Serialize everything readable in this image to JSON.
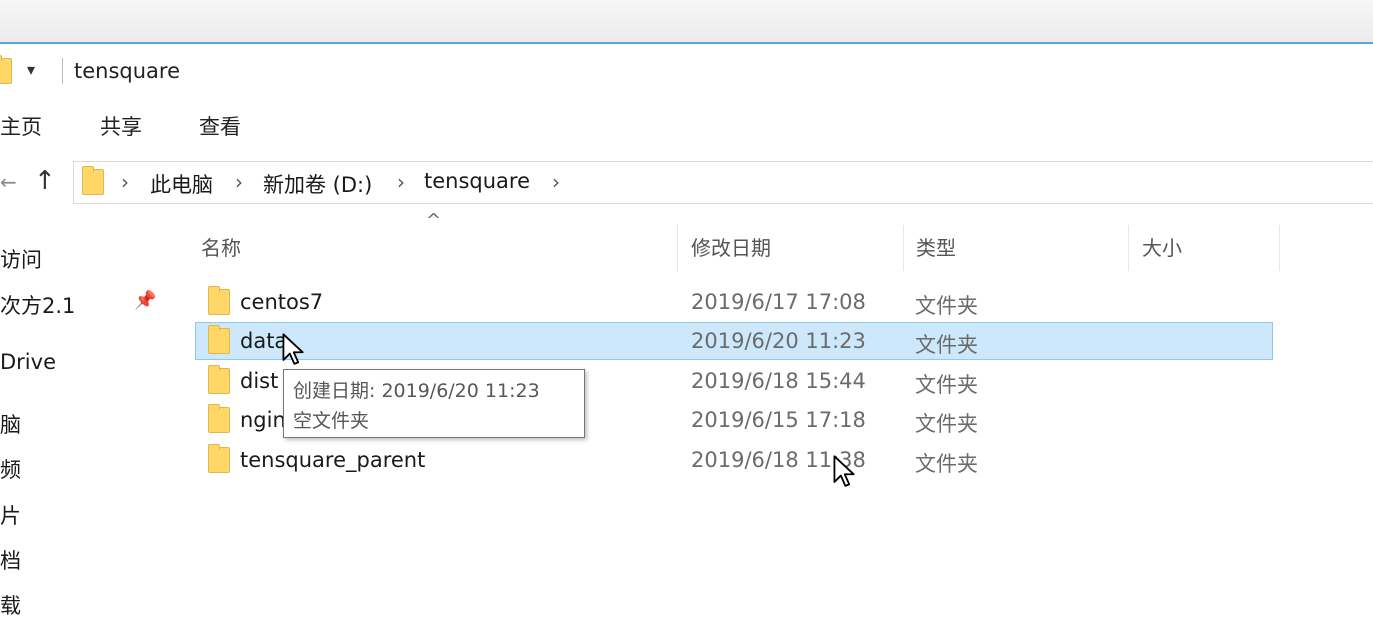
{
  "window": {
    "title": "tensquare",
    "quick_access_dropdown": "▾"
  },
  "ribbon": {
    "tabs": [
      {
        "label": "主页"
      },
      {
        "label": "共享"
      },
      {
        "label": "查看"
      }
    ]
  },
  "address_bar": {
    "back_glyph": "←",
    "up_glyph": "↑",
    "separator": "›",
    "breadcrumbs": [
      {
        "label": "此电脑"
      },
      {
        "label": "新加卷 (D:)"
      },
      {
        "label": "tensquare"
      }
    ]
  },
  "nav_pane": {
    "items": [
      {
        "label": "访问"
      },
      {
        "label": "次方2.1"
      },
      {
        "label": "Drive"
      },
      {
        "label": "脑"
      },
      {
        "label": "频"
      },
      {
        "label": "片"
      },
      {
        "label": "档"
      },
      {
        "label": "载"
      }
    ]
  },
  "file_list": {
    "sort_glyph": "^",
    "columns": {
      "name": "名称",
      "modified": "修改日期",
      "type": "类型",
      "size": "大小"
    },
    "rows": [
      {
        "name": "centos7",
        "modified": "2019/6/17 17:08",
        "type": "文件夹",
        "selected": false
      },
      {
        "name": "data",
        "modified": "2019/6/20 11:23",
        "type": "文件夹",
        "selected": true
      },
      {
        "name": "dist",
        "modified": "2019/6/18 15:44",
        "type": "文件夹",
        "selected": false
      },
      {
        "name": "nginx",
        "modified": "2019/6/15 17:18",
        "type": "文件夹",
        "selected": false
      },
      {
        "name": "tensquare_parent",
        "modified": "2019/6/18 11:38",
        "type": "文件夹",
        "selected": false
      }
    ]
  },
  "tooltip": {
    "created": "创建日期: 2019/6/20 11:23",
    "info": "空文件夹"
  },
  "colors": {
    "accent": "#5aa9dc",
    "selection_fill": "#cde8fa",
    "selection_border": "#8fc9f0",
    "folder": "#ffd766"
  }
}
